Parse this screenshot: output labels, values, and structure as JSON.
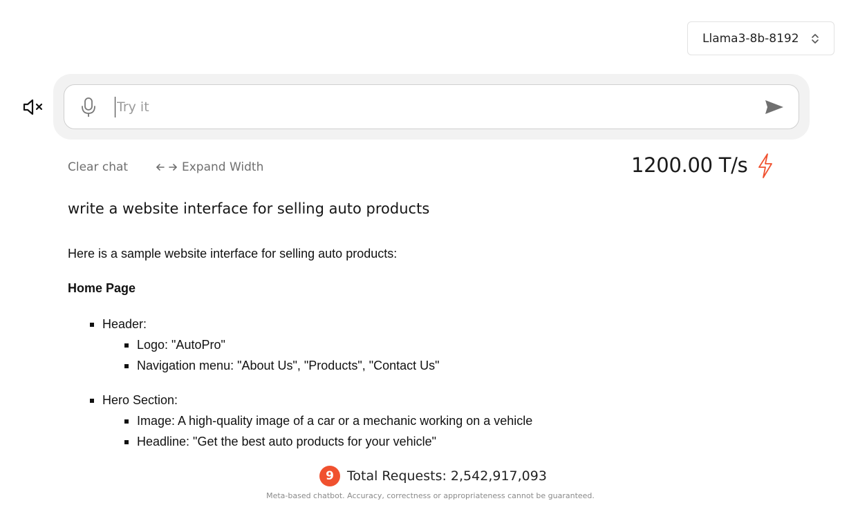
{
  "model_selector": {
    "selected": "Llama3-8b-8192"
  },
  "icons": {
    "mute": "speaker-muted-icon",
    "mic": "microphone-icon",
    "send": "send-arrow-icon",
    "chevron": "chevron-updown-icon",
    "expand": "arrows-left-right-icon",
    "bolt": "lightning-bolt-icon"
  },
  "chat_input": {
    "placeholder": "Try it",
    "value": ""
  },
  "toolbar": {
    "clear_label": "Clear chat",
    "expand_label": "Expand Width",
    "speed": "1200.00 T/s"
  },
  "conversation": {
    "user_message": "write a website interface for selling auto products",
    "response": {
      "intro": "Here is a sample website interface for selling auto products:",
      "section_title": "Home Page",
      "items": [
        {
          "label": "Header:",
          "sub": [
            "Logo: \"AutoPro\"",
            "Navigation menu: \"About Us\", \"Products\", \"Contact Us\""
          ]
        },
        {
          "label": "Hero Section:",
          "sub": [
            "Image: A high-quality image of a car or a mechanic working on a vehicle",
            "Headline: \"Get the best auto products for your vehicle\""
          ]
        }
      ]
    }
  },
  "footer": {
    "badge": "9",
    "total_requests": "Total Requests: 2,542,917,093",
    "disclaimer": "Meta-based chatbot. Accuracy, correctness or appropriateness cannot be guaranteed."
  },
  "colors": {
    "accent": "#f0512f",
    "muted_text": "#6f6f6f",
    "shell_bg": "#f2f2f2"
  }
}
